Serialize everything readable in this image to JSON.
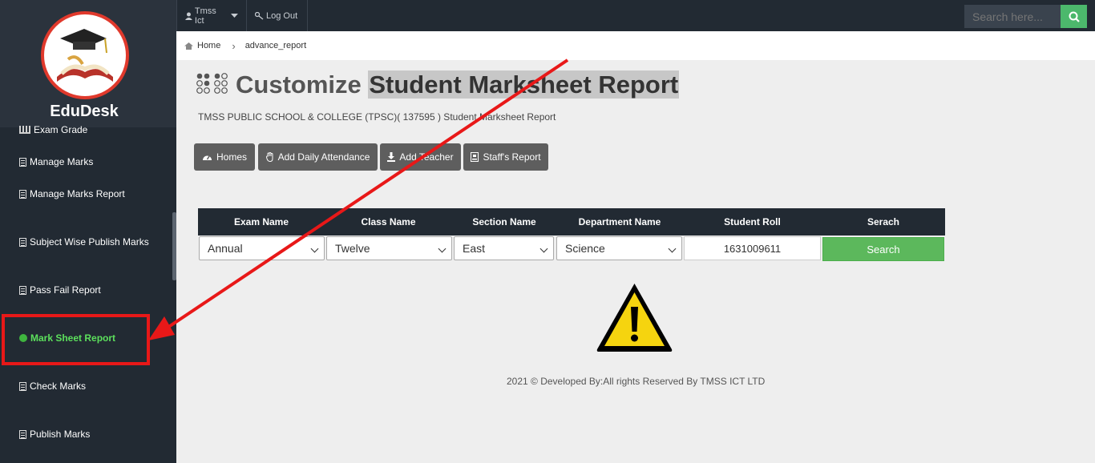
{
  "sidebar": {
    "brand_name": "EduDesk",
    "items": [
      {
        "label": "Exam Grade",
        "icon": "bank-icon"
      },
      {
        "label": "Manage Marks",
        "icon": "document-icon"
      },
      {
        "label": "Manage Marks Report",
        "icon": "document-icon"
      },
      {
        "label": "Subject Wise Publish Marks",
        "icon": "document-icon"
      },
      {
        "label": "Pass Fail Report",
        "icon": "document-icon"
      },
      {
        "label": "Mark Sheet Report",
        "icon": "dot-icon",
        "active": true
      },
      {
        "label": "Check Marks",
        "icon": "document-icon"
      },
      {
        "label": "Publish Marks",
        "icon": "document-icon"
      }
    ],
    "active_color": "#5ce05c"
  },
  "topbar": {
    "user_label": "Tmss Ict",
    "logout_label": "Log Out",
    "search_placeholder": "Search here..."
  },
  "breadcrumb": {
    "home": "Home",
    "current": "advance_report"
  },
  "header": {
    "title_plain": "Customize",
    "title_highlight": "Student Marksheet Report",
    "subtitle": "TMSS PUBLIC SCHOOL & COLLEGE (TPSC)( 137595 ) Student Marksheet Report"
  },
  "quick_buttons": {
    "homes": "Homes",
    "attendance": "Add Daily Attendance",
    "teacher": "Add Teacher",
    "staff": "Staff's Report"
  },
  "table": {
    "headers": [
      "Exam Name",
      "Class Name",
      "Section Name",
      "Department Name",
      "Student Roll",
      "Serach"
    ],
    "exam": "Annual",
    "class": "Twelve",
    "section": "East",
    "department": "Science",
    "roll": "1631009611",
    "search_label": "Search"
  },
  "footer": "2021 © Developed By:All rights Reserved By TMSS ICT LTD",
  "colors": {
    "sidebar_bg": "#222a33",
    "search_green": "#5cb85c",
    "annotation_red": "#e81818"
  }
}
